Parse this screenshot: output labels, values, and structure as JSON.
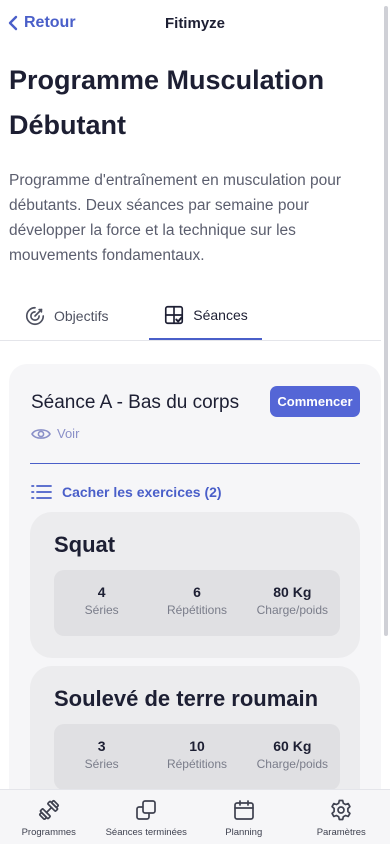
{
  "header": {
    "back_label": "Retour",
    "app_title": "Fitimyze"
  },
  "program": {
    "title": "Programme Musculation Débutant",
    "description": "Programme d'entraînement en musculation pour débutants. Deux séances par semaine pour développer la force et la technique sur les mouvements fondamentaux."
  },
  "tabs": [
    {
      "label": "Objectifs",
      "icon": "target-icon",
      "active": false
    },
    {
      "label": "Séances",
      "icon": "grid-check-icon",
      "active": true
    }
  ],
  "session": {
    "title": "Séance A - Bas du corps",
    "start_label": "Commencer",
    "view_label": "Voir",
    "toggle_label": "Cacher les exercices (2)"
  },
  "exercises": [
    {
      "name": "Squat",
      "stats": [
        {
          "value": "4",
          "label": "Séries"
        },
        {
          "value": "6",
          "label": "Répétitions"
        },
        {
          "value": "80 Kg",
          "label": "Charge/poids"
        }
      ]
    },
    {
      "name": "Soulevé de terre roumain",
      "stats": [
        {
          "value": "3",
          "label": "Séries"
        },
        {
          "value": "10",
          "label": "Répétitions"
        },
        {
          "value": "60 Kg",
          "label": "Charge/poids"
        }
      ]
    }
  ],
  "bottom_nav": [
    {
      "label": "Programmes",
      "icon": "dumbbell-icon"
    },
    {
      "label": "Séances terminées",
      "icon": "copy-icon"
    },
    {
      "label": "Planning",
      "icon": "calendar-icon"
    },
    {
      "label": "Paramètres",
      "icon": "gear-icon"
    }
  ],
  "colors": {
    "accent": "#4a5fc9",
    "button": "#5466d6",
    "text": "#1d1f33"
  }
}
